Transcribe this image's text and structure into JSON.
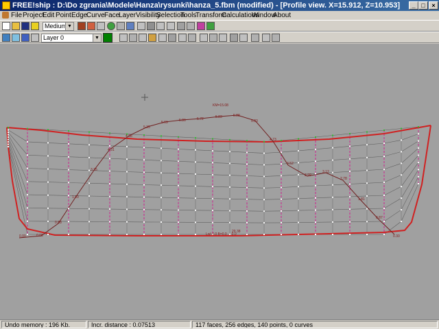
{
  "window": {
    "title": "FREE!ship   : D:\\Do zgrania\\Modele\\Hanza\\rysunki\\hanza_5.fbm (modified) - [Profile view.  X=15.912,  Z=10.953]",
    "minimize": "_",
    "maximize": "□",
    "close": "×"
  },
  "menu": [
    "File",
    "Project",
    "Edit",
    "Point",
    "Edge",
    "Curve",
    "Face",
    "Layer",
    "Visibility",
    "Selection",
    "Tools",
    "Transform",
    "Calculations",
    "Window",
    "About"
  ],
  "toolbar": {
    "precision_value": "Medium",
    "layer_value": "Layer 0",
    "layer_color": "#008000"
  },
  "viewport": {
    "background": "#a0a0a0",
    "labels": {
      "km": "KM=15.08",
      "baseline": "Lwl-0.0 B=0.0 ... 0.0",
      "baseline2": "29.38",
      "curve_values": [
        "0.00",
        "0.08",
        "0.88",
        "1.90",
        "3.35",
        "4.31",
        "4.88",
        "5.35",
        "5.69",
        "5.86",
        "5.72",
        "5.83",
        "5.88",
        "5.83",
        "4.73",
        "3.52",
        "2.99",
        "3.12",
        "2.78",
        "1.81",
        "0.87",
        "0.30"
      ]
    }
  },
  "status": {
    "undo": "Undo memory : 196 Kb.",
    "incr": "Incr. distance : 0.07513",
    "counts": "117 faces, 256 edges, 140 points, 0 curves"
  }
}
